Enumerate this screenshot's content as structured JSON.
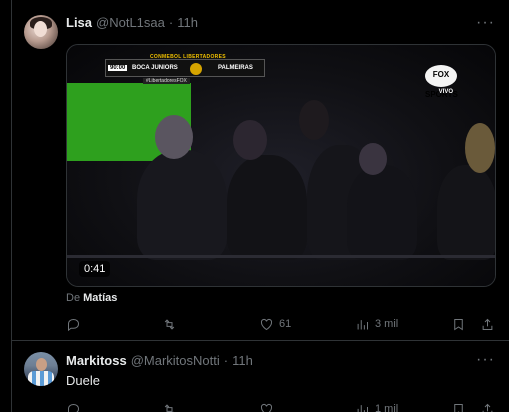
{
  "tweets": [
    {
      "name": "Lisa",
      "handle": "@NotL1saa",
      "time": "11h",
      "more": "···",
      "video": {
        "duration": "0:41",
        "overlay": {
          "competition": "CONMEBOL LIBERTADORES",
          "clock": "90:00",
          "home": "BOCA JUNIORS",
          "away": "PALMEIRAS",
          "hashtag": "#LibertadoresFOX",
          "broadcaster": "FOX SPORTS",
          "live": "VIVO"
        }
      },
      "from_prefix": "De",
      "from_name": "Matías",
      "actions": {
        "likes": "61",
        "views": "3 mil"
      }
    },
    {
      "name": "Markitoss",
      "handle": "@MarkitosNotti",
      "time": "11h",
      "more": "···",
      "text": "Duele",
      "actions": {
        "views": "1 mil"
      }
    }
  ],
  "colors": {
    "background": "#000000",
    "text": "#e7e9ea",
    "muted": "#71767b",
    "border": "#2f3336"
  }
}
